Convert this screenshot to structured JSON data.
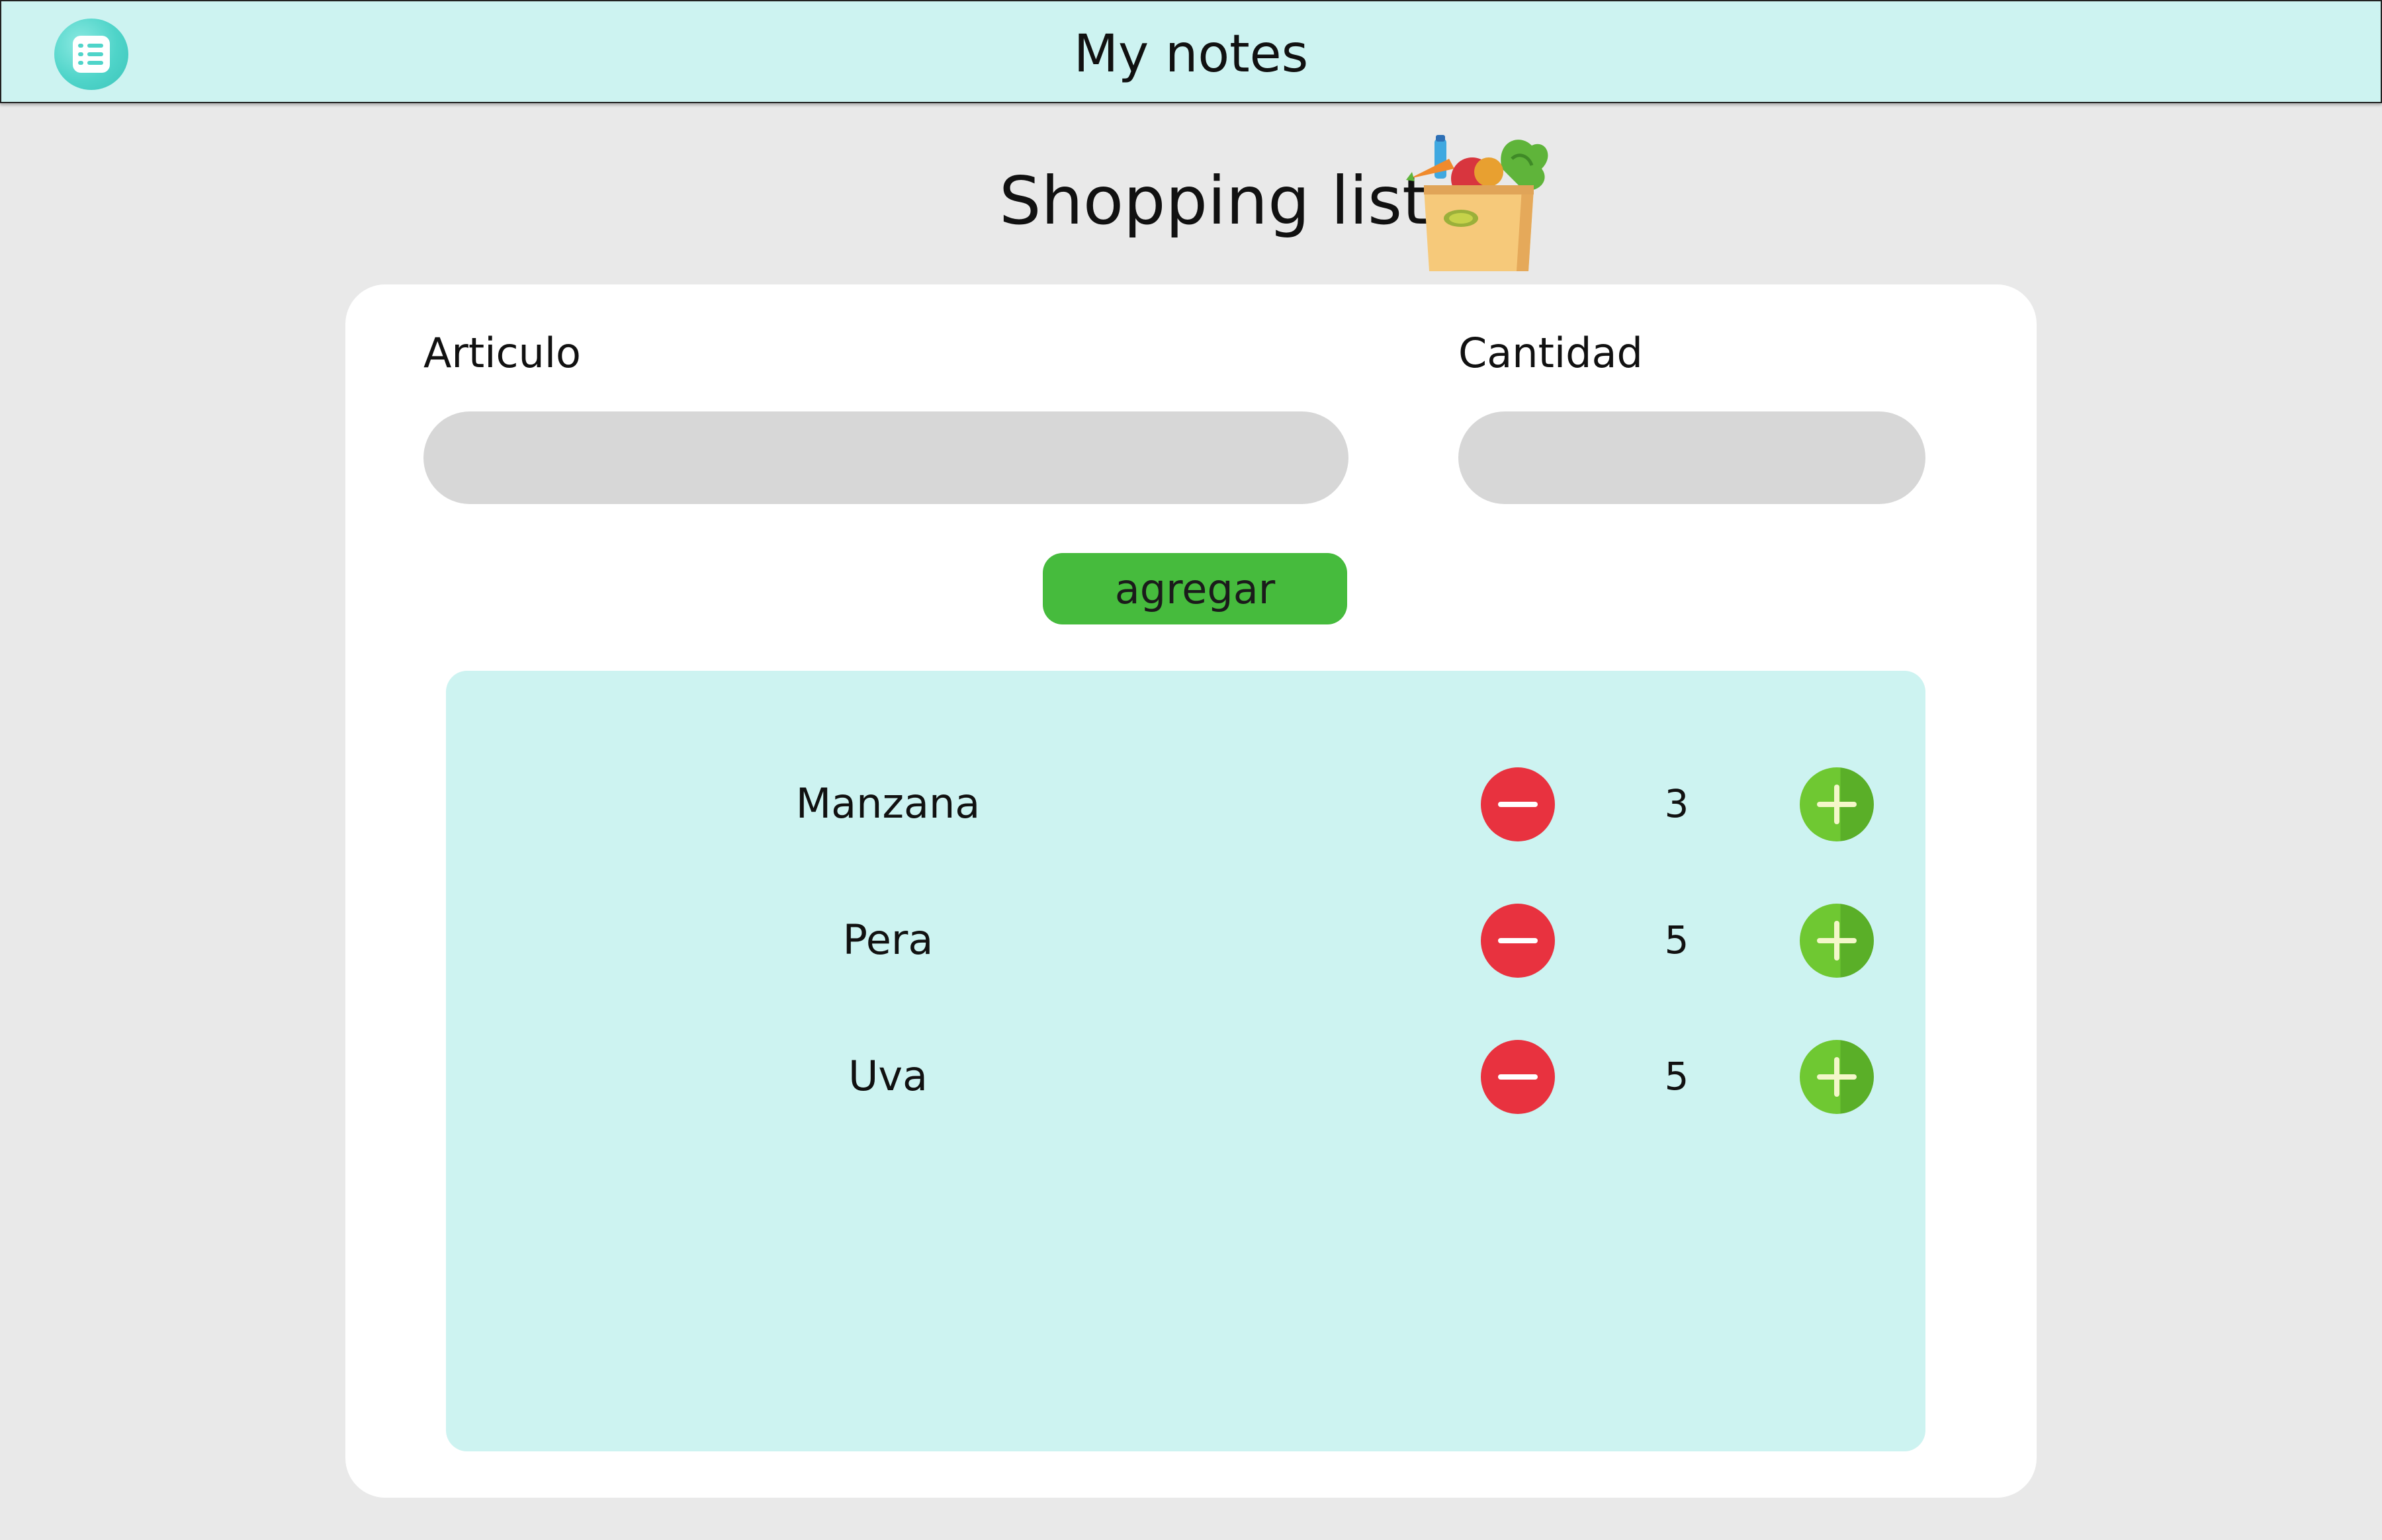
{
  "header": {
    "title": "My notes",
    "icon": "notes-list-icon"
  },
  "page": {
    "title": "Shopping list",
    "icon": "grocery-bag-icon"
  },
  "form": {
    "item_label": "Articulo",
    "item_value": "",
    "quantity_label": "Cantidad",
    "quantity_value": "",
    "add_label": "agregar"
  },
  "list": {
    "items": [
      {
        "name": "Manzana",
        "quantity": "3"
      },
      {
        "name": "Pera",
        "quantity": "5"
      },
      {
        "name": "Uva",
        "quantity": "5"
      }
    ]
  },
  "colors": {
    "header_bg": "#cdf3f1",
    "page_bg": "#e9e9e9",
    "add_button": "#46bb3d",
    "decrement": "#e8323f",
    "increment": "#6fc832",
    "list_bg": "#cdf3f1"
  }
}
